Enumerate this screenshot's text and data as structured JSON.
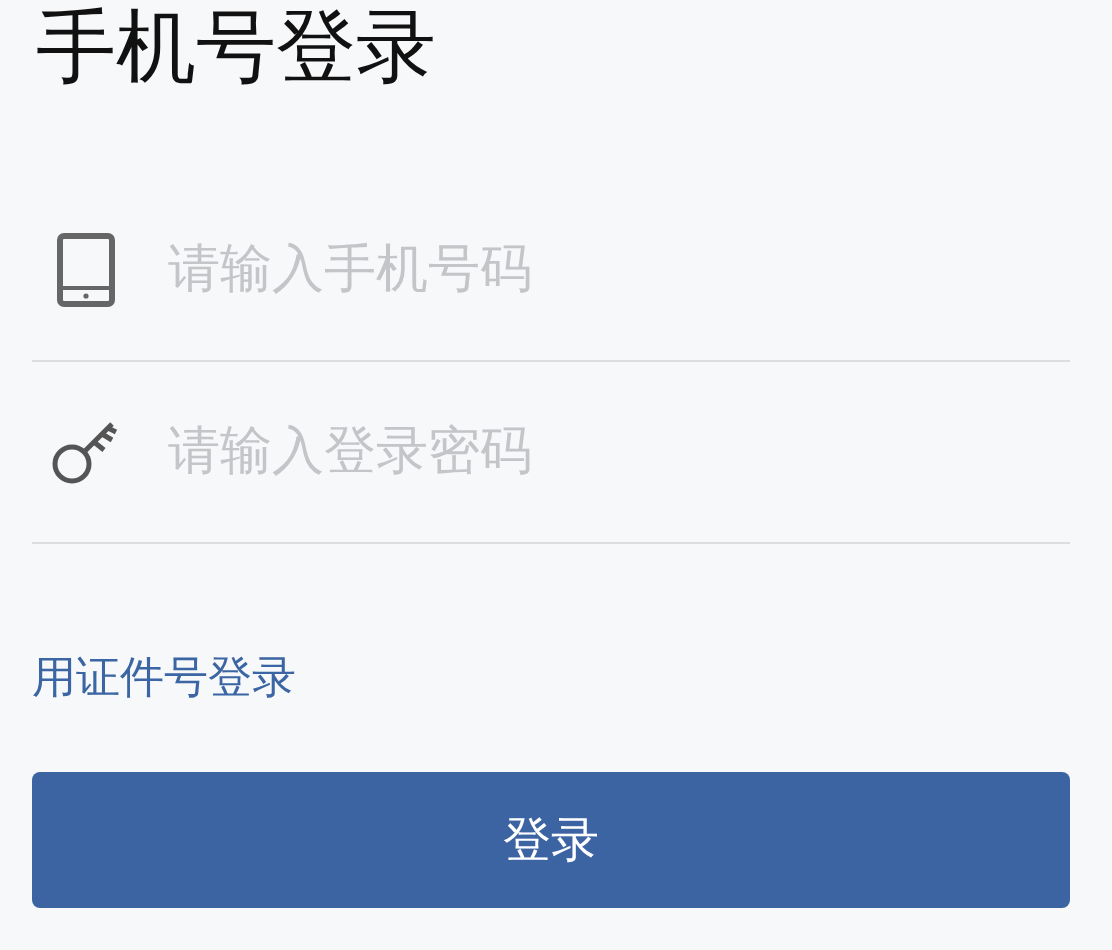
{
  "title": "手机号登录",
  "fields": [
    {
      "kind": "phone",
      "placeholder": "请输入手机号码"
    },
    {
      "kind": "password",
      "placeholder": "请输入登录密码"
    }
  ],
  "alt_login_link": "用证件号登录",
  "submit_button": "登录"
}
